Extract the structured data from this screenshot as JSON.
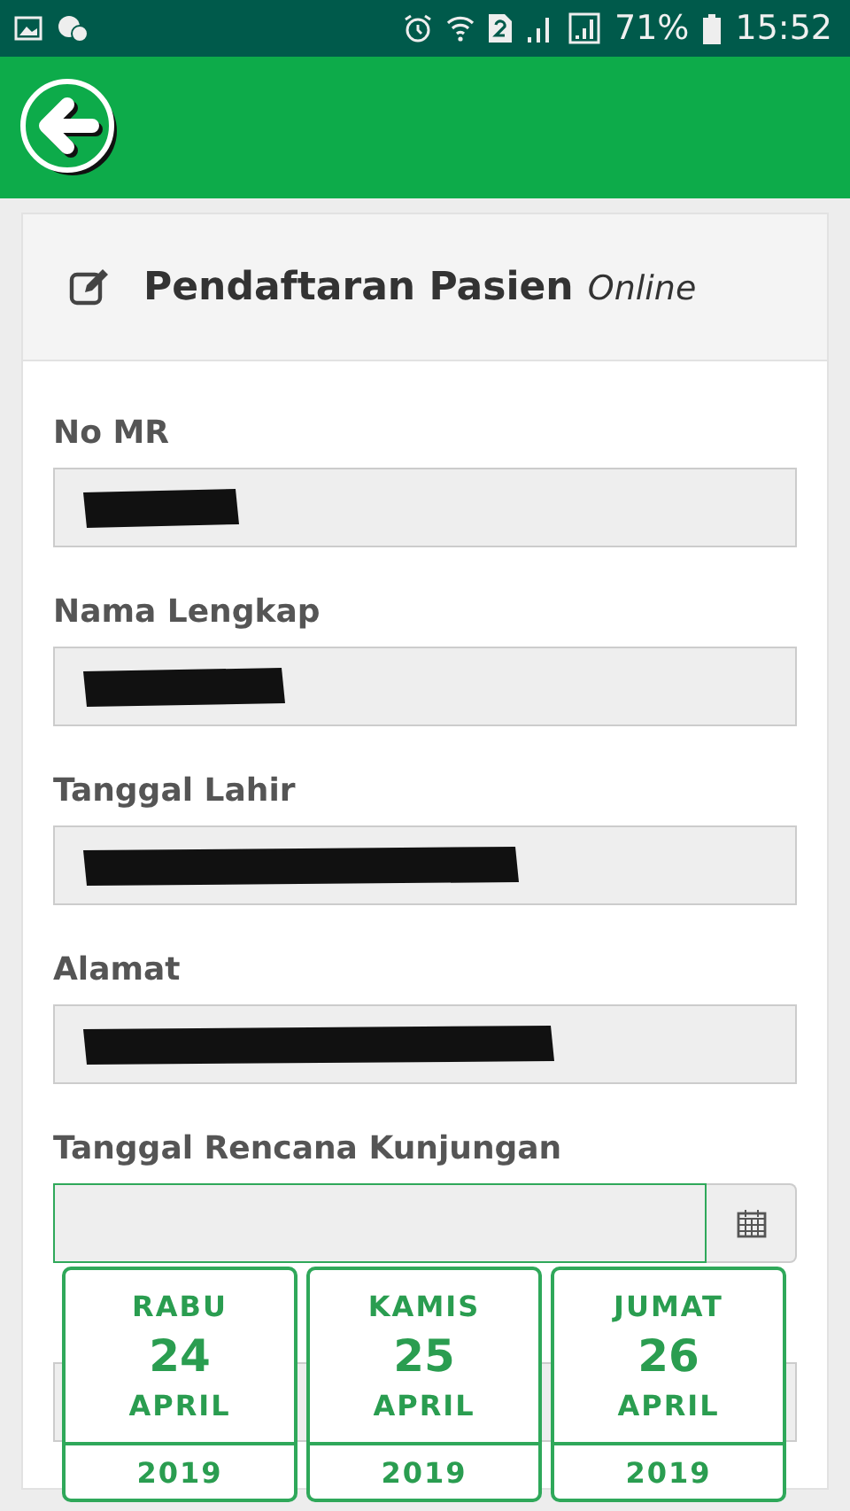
{
  "status_bar": {
    "battery": "71%",
    "time": "15:52"
  },
  "card": {
    "title": "Pendaftaran Pasien",
    "title_suffix": "Online"
  },
  "fields": [
    {
      "label": "No MR",
      "kind": "redacted"
    },
    {
      "label": "Nama Lengkap",
      "kind": "redacted"
    },
    {
      "label": "Tanggal Lahir",
      "kind": "redacted"
    },
    {
      "label": "Alamat",
      "kind": "redacted"
    },
    {
      "label": "Tanggal Rencana Kunjungan",
      "kind": "date"
    }
  ],
  "date_options": [
    {
      "day": "RABU",
      "date": "24",
      "month": "APRIL",
      "year": "2019"
    },
    {
      "day": "KAMIS",
      "date": "25",
      "month": "APRIL",
      "year": "2019"
    },
    {
      "day": "JUMAT",
      "date": "26",
      "month": "APRIL",
      "year": "2019"
    }
  ]
}
